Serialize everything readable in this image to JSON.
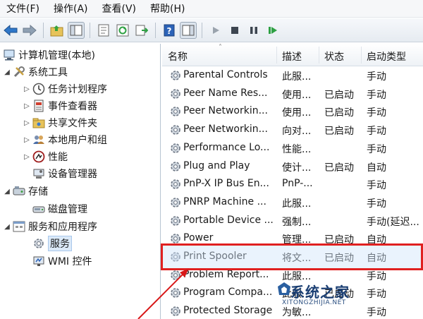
{
  "menu": [
    "文件(F)",
    "操作(A)",
    "查看(V)",
    "帮助(H)"
  ],
  "toolbar": {
    "icons": [
      "back-arrow-icon",
      "forward-arrow-icon",
      "folder-up-icon",
      "show-hide-tree-icon",
      "properties-icon",
      "refresh-icon",
      "export-list-icon",
      "help-icon",
      "show-action-pane-icon",
      "start-icon",
      "stop-icon",
      "pause-icon",
      "restart-icon"
    ]
  },
  "tree": {
    "root": "计算机管理(本地)",
    "system_tools": "系统工具",
    "task_scheduler": "任务计划程序",
    "event_viewer": "事件查看器",
    "shared_folders": "共享文件夹",
    "local_users": "本地用户和组",
    "performance": "性能",
    "device_manager": "设备管理器",
    "storage": "存储",
    "disk_management": "磁盘管理",
    "services_apps": "服务和应用程序",
    "services": "服务",
    "wmi": "WMI 控件"
  },
  "list": {
    "headers": {
      "name": "名称",
      "desc": "描述",
      "status": "状态",
      "startup": "启动类型"
    },
    "rows": [
      {
        "name": "Parental Controls",
        "desc": "此服...",
        "status": "",
        "startup": "手动"
      },
      {
        "name": "Peer Name Res...",
        "desc": "使用...",
        "status": "已启动",
        "startup": "手动"
      },
      {
        "name": "Peer Networkin...",
        "desc": "使用...",
        "status": "已启动",
        "startup": "手动"
      },
      {
        "name": "Peer Networkin...",
        "desc": "向对...",
        "status": "已启动",
        "startup": "手动"
      },
      {
        "name": "Performance Lo...",
        "desc": "性能...",
        "status": "",
        "startup": "手动"
      },
      {
        "name": "Plug and Play",
        "desc": "使计...",
        "status": "已启动",
        "startup": "自动"
      },
      {
        "name": "PnP-X IP Bus En...",
        "desc": "PnP-...",
        "status": "",
        "startup": "手动"
      },
      {
        "name": "PNRP Machine ...",
        "desc": "此服...",
        "status": "",
        "startup": "手动"
      },
      {
        "name": "Portable Device ...",
        "desc": "强制...",
        "status": "",
        "startup": "手动(延迟..."
      },
      {
        "name": "Power",
        "desc": "管理...",
        "status": "已启动",
        "startup": "自动"
      },
      {
        "name": "Print Spooler",
        "desc": "将文...",
        "status": "已启动",
        "startup": "自动"
      },
      {
        "name": "Problem Report...",
        "desc": "此服...",
        "status": "",
        "startup": "手动"
      },
      {
        "name": "Program Compa...",
        "desc": "此服...",
        "status": "已启动",
        "startup": "手动"
      },
      {
        "name": "Protected Storage",
        "desc": "为敏...",
        "status": "",
        "startup": "手动"
      }
    ]
  },
  "watermark": {
    "text": "系统之家",
    "sub": "XITONGZHIJIA.NET"
  },
  "colors": {
    "highlight_border": "#e02020",
    "selection": "#dbe9f8"
  }
}
